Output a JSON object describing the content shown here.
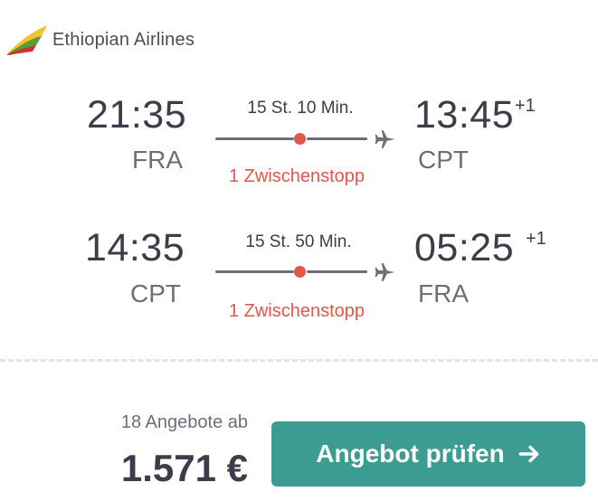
{
  "airline": {
    "name": "Ethiopian Airlines",
    "logo_icon": "ethiopian-airlines-logo"
  },
  "legs": [
    {
      "departure_time": "21:35",
      "departure_airport": "FRA",
      "duration": "15 St. 10 Min.",
      "stops_label": "1 Zwischenstopp",
      "arrival_time": "13:45",
      "arrival_day_offset": "+1",
      "arrival_airport": "CPT"
    },
    {
      "departure_time": "14:35",
      "departure_airport": "CPT",
      "duration": "15 St. 50 Min.",
      "stops_label": "1 Zwischenstopp",
      "arrival_time": "05:25",
      "arrival_day_offset": "+1",
      "arrival_airport": "FRA"
    }
  ],
  "pricing": {
    "offers_label": "18 Angebote ab",
    "price": "1.571 €"
  },
  "cta": {
    "label": "Angebot prüfen",
    "icon": "arrow-right-icon"
  },
  "colors": {
    "accent_teal": "#3c9c91",
    "stop_red": "#e3564d",
    "text_dark": "#3b3e49",
    "text_muted": "#6c6f7a"
  }
}
